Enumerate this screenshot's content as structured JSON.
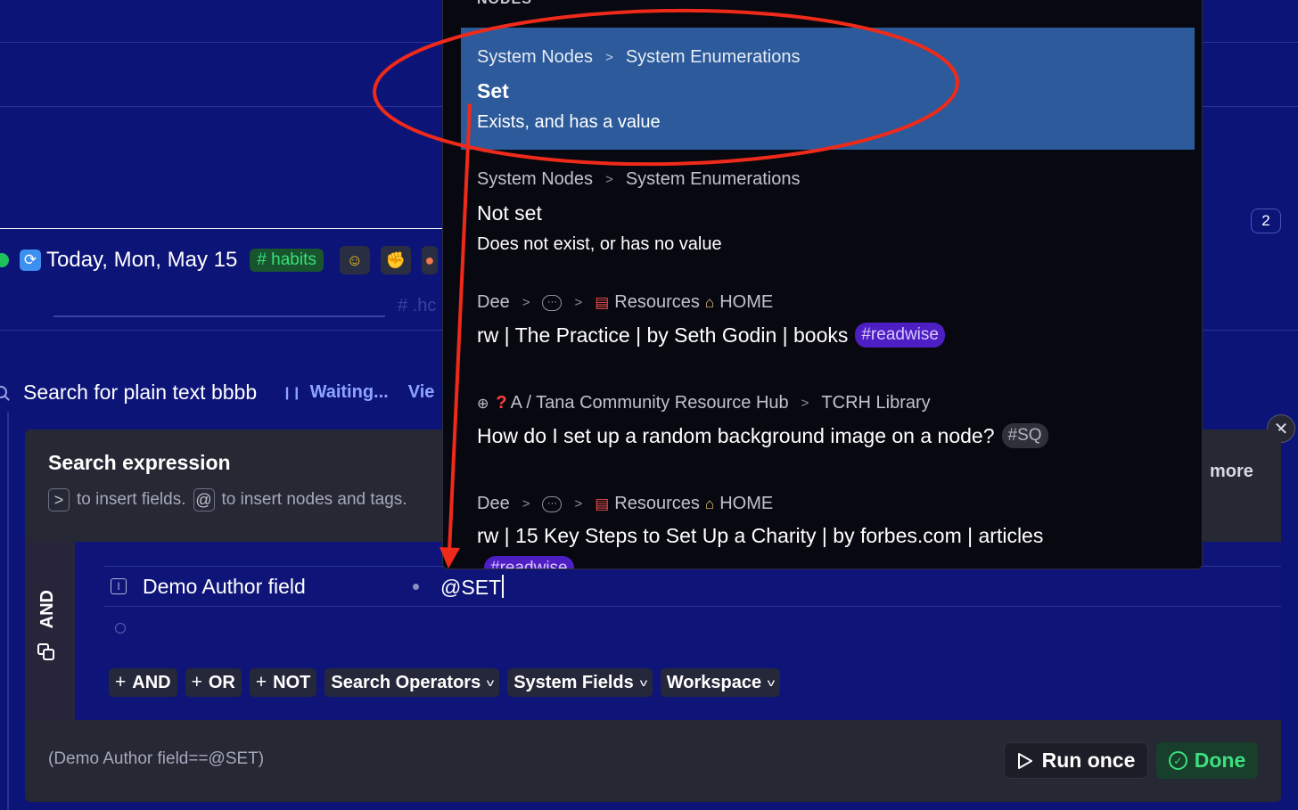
{
  "background": {
    "daily": {
      "title": "Today, Mon, May 15",
      "tag": "# habits",
      "ghost_tag": "# .hc",
      "count_badge": "2"
    },
    "search_bar": {
      "title": "Search for plain text bbbb",
      "status": "Waiting...",
      "view_link": "Vie"
    }
  },
  "panel": {
    "title": "Search expression",
    "hint_key_field": ">",
    "hint_text_field": "to insert fields.",
    "hint_key_node": "@",
    "hint_text_node": "to insert nodes and tags.",
    "more_label": "more",
    "group_operator": "AND",
    "condition": {
      "field": "Demo Author field",
      "value": "@SET"
    },
    "buttons": [
      {
        "label": "AND",
        "prefix": "+"
      },
      {
        "label": "OR",
        "prefix": "+"
      },
      {
        "label": "NOT",
        "prefix": "+"
      },
      {
        "label": "Search Operators",
        "dropdown": true
      },
      {
        "label": "System Fields",
        "dropdown": true
      },
      {
        "label": "Workspace",
        "dropdown": true
      }
    ],
    "expression": "(Demo Author field==@SET)",
    "run_label": "Run once",
    "done_label": "Done"
  },
  "popup": {
    "header": "NODES",
    "items": [
      {
        "crumb": [
          "System Nodes",
          "System Enumerations"
        ],
        "title": "Set",
        "description": "Exists, and has a value",
        "selected": true
      },
      {
        "crumb": [
          "System Nodes",
          "System Enumerations"
        ],
        "title": "Not set",
        "description": "Does not exist, or has no value",
        "selected": false
      },
      {
        "crumb_parts": {
          "root": "Dee",
          "ellipsis": "···",
          "resources": "Resources",
          "home": "HOME"
        },
        "title": "rw | The Practice | by Seth Godin | books",
        "tag": "#readwise"
      },
      {
        "crumb_parts": {
          "a": "A / Tana Community Resource Hub",
          "lib": "TCRH Library"
        },
        "title": "How do I set up a random background image on a node?",
        "tag": "#SQ"
      },
      {
        "crumb_parts": {
          "root": "Dee",
          "ellipsis": "···",
          "resources": "Resources",
          "home": "HOME"
        },
        "title": "rw | 15 Key Steps to Set Up a Charity | by forbes.com | articles",
        "tag": "#readwise"
      }
    ]
  },
  "colors": {
    "page_bg": "#0d1478",
    "panel_bg": "#262834",
    "popup_bg": "#080910",
    "selected_bg": "#2c5a9a",
    "annotation": "#f02a1a",
    "tag_purple": "#4d1ec3",
    "success": "#3ce07e"
  },
  "icons": [
    "sync-icon",
    "search-icon",
    "field-icon",
    "play-icon",
    "check-circle-icon",
    "close-icon",
    "chevron-right-icon",
    "books-icon",
    "home-icon",
    "globe-icon"
  ]
}
